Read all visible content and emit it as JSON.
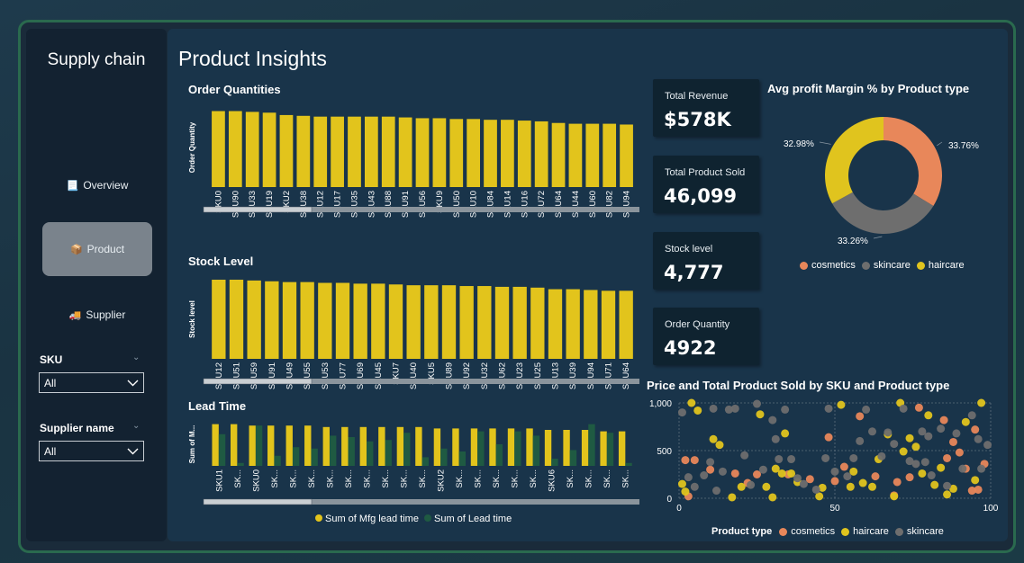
{
  "app": {
    "title": "Supply chain"
  },
  "nav": [
    {
      "label": "Overview",
      "icon": "document-icon"
    },
    {
      "label": "Product",
      "icon": "box-icon"
    },
    {
      "label": "Supplier",
      "icon": "truck-icon"
    }
  ],
  "filters": {
    "sku": {
      "label": "SKU",
      "value": "All"
    },
    "supplier": {
      "label": "Supplier name",
      "value": "All"
    }
  },
  "page": {
    "title": "Product Insights"
  },
  "colors": {
    "yellow": "#e2c41c",
    "green": "#1f5a42",
    "cosmetics": "#e8875a",
    "skincare": "#6e6e6e",
    "haircare": "#e0c41e"
  },
  "kpis": [
    {
      "label": "Total Revenue",
      "value": "$578K"
    },
    {
      "label": "Total Product Sold",
      "value": "46,099"
    },
    {
      "label": "Stock level",
      "value": "4,777"
    },
    {
      "label": "Order Quantity",
      "value": "4922"
    }
  ],
  "order_quantities": {
    "title": "Order Quantities",
    "ylabel": "Order Quantity"
  },
  "stock_level": {
    "title": "Stock Level",
    "ylabel": "Stock level"
  },
  "lead_time": {
    "title": "Lead Time",
    "ylabel": "Sum of M...",
    "legend": [
      "Sum of Mfg lead time",
      "Sum of Lead time"
    ]
  },
  "donut": {
    "title": "Avg profit Margin % by Product type",
    "labels": [
      "33.76%",
      "33.26%",
      "32.98%"
    ],
    "legend": [
      "cosmetics",
      "skincare",
      "haircare"
    ]
  },
  "scatter": {
    "title": "Price and Total Product Sold by SKU and Product type",
    "legend_title": "Product type",
    "legend": [
      "cosmetics",
      "haircare",
      "skincare"
    ],
    "y_ticks": [
      "1,000",
      "500",
      "0"
    ],
    "x_ticks": [
      "0",
      "50",
      "100"
    ]
  },
  "chart_data": [
    {
      "type": "bar",
      "title": "Order Quantities",
      "xlabel": "",
      "ylabel": "Order Quantity",
      "categories": [
        "SKU0",
        "SKU90",
        "SKU33",
        "SKU19",
        "SKU2",
        "SKU38",
        "SKU12",
        "SKU17",
        "SKU35",
        "SKU43",
        "SKU88",
        "SKU91",
        "SKU56",
        "SKU9",
        "SKU50",
        "SKU10",
        "SKU84",
        "SKU14",
        "SKU16",
        "SKU72",
        "SKU64",
        "SKU44",
        "SKU60",
        "SKU82",
        "SKU94"
      ],
      "values": [
        96,
        96,
        95,
        94,
        91,
        90,
        89,
        89,
        89,
        89,
        89,
        88,
        87,
        87,
        86,
        86,
        85,
        85,
        84,
        83,
        81,
        80,
        80,
        80,
        79
      ],
      "ylim": [
        0,
        100
      ]
    },
    {
      "type": "bar",
      "title": "Stock Level",
      "xlabel": "",
      "ylabel": "Stock level",
      "categories": [
        "SKU12",
        "SKU51",
        "SKU59",
        "SKU91",
        "SKU49",
        "SKU55",
        "SKU53",
        "SKU77",
        "SKU69",
        "SKU45",
        "SKU7",
        "SKU40",
        "SKU5",
        "SKU89",
        "SKU92",
        "SKU32",
        "SKU62",
        "SKU23",
        "SKU25",
        "SKU13",
        "SKU39",
        "SKU94",
        "SKU71",
        "SKU64"
      ],
      "values": [
        100,
        100,
        99,
        98,
        97,
        97,
        96,
        96,
        95,
        95,
        94,
        93,
        93,
        93,
        92,
        92,
        91,
        91,
        90,
        88,
        88,
        87,
        86,
        86
      ],
      "ylim": [
        0,
        100
      ]
    },
    {
      "type": "bar",
      "title": "Lead Time",
      "xlabel": "",
      "ylabel": "Sum of M...",
      "categories": [
        "SKU1",
        "SK...",
        "SKU0",
        "SK...",
        "SK...",
        "SK...",
        "SK...",
        "SK...",
        "SK...",
        "SK...",
        "SK...",
        "SK...",
        "SKU2",
        "SK...",
        "SK...",
        "SK...",
        "SK...",
        "SK...",
        "SKU6",
        "SK...",
        "SK...",
        "SK...",
        "SK..."
      ],
      "series": [
        {
          "name": "Sum of Mfg lead time",
          "values": [
            29,
            29,
            28,
            28,
            28,
            28,
            27,
            27,
            27,
            27,
            27,
            27,
            26,
            26,
            26,
            26,
            26,
            26,
            25,
            25,
            25,
            24,
            24
          ]
        },
        {
          "name": "Sum of Lead time",
          "values": [
            22,
            2,
            28,
            7,
            13,
            12,
            21,
            20,
            17,
            18,
            23,
            6,
            12,
            10,
            24,
            15,
            24,
            21,
            5,
            11,
            29,
            23,
            2
          ]
        }
      ],
      "ylim": [
        0,
        30
      ]
    },
    {
      "type": "pie",
      "title": "Avg profit Margin % by Product type",
      "categories": [
        "cosmetics",
        "skincare",
        "haircare"
      ],
      "values": [
        33.76,
        33.26,
        32.98
      ]
    },
    {
      "type": "scatter",
      "title": "Price and Total Product Sold by SKU and Product type",
      "xlim": [
        0,
        100
      ],
      "ylim": [
        0,
        1000
      ],
      "series": [
        {
          "name": "cosmetics",
          "points": [
            [
              2,
              400
            ],
            [
              3,
              20
            ],
            [
              5,
              400
            ],
            [
              10,
              300
            ],
            [
              18,
              260
            ],
            [
              22,
              160
            ],
            [
              25,
              250
            ],
            [
              35,
              250
            ],
            [
              42,
              200
            ],
            [
              48,
              640
            ],
            [
              50,
              180
            ],
            [
              53,
              330
            ],
            [
              58,
              860
            ],
            [
              63,
              230
            ],
            [
              69,
              30
            ],
            [
              70,
              170
            ],
            [
              74,
              220
            ],
            [
              77,
              950
            ],
            [
              85,
              820
            ],
            [
              86,
              420
            ],
            [
              88,
              590
            ],
            [
              90,
              480
            ],
            [
              92,
              310
            ],
            [
              94,
              80
            ],
            [
              95,
              720
            ],
            [
              96,
              90
            ],
            [
              98,
              360
            ]
          ]
        },
        {
          "name": "haircare",
          "points": [
            [
              1,
              150
            ],
            [
              2,
              70
            ],
            [
              4,
              1000
            ],
            [
              6,
              920
            ],
            [
              11,
              620
            ],
            [
              13,
              560
            ],
            [
              17,
              10
            ],
            [
              20,
              120
            ],
            [
              26,
              880
            ],
            [
              28,
              120
            ],
            [
              30,
              10
            ],
            [
              31,
              310
            ],
            [
              33,
              260
            ],
            [
              34,
              680
            ],
            [
              36,
              260
            ],
            [
              38,
              170
            ],
            [
              45,
              20
            ],
            [
              46,
              110
            ],
            [
              52,
              980
            ],
            [
              55,
              120
            ],
            [
              56,
              280
            ],
            [
              59,
              160
            ],
            [
              62,
              120
            ],
            [
              64,
              410
            ],
            [
              67,
              670
            ],
            [
              69,
              20
            ],
            [
              71,
              1000
            ],
            [
              72,
              490
            ],
            [
              74,
              630
            ],
            [
              76,
              540
            ],
            [
              78,
              260
            ],
            [
              80,
              870
            ],
            [
              82,
              140
            ],
            [
              84,
              320
            ],
            [
              86,
              40
            ],
            [
              88,
              100
            ],
            [
              92,
              800
            ],
            [
              95,
              190
            ],
            [
              97,
              1000
            ]
          ]
        },
        {
          "name": "skincare",
          "points": [
            [
              1,
              900
            ],
            [
              3,
              220
            ],
            [
              5,
              120
            ],
            [
              8,
              240
            ],
            [
              10,
              380
            ],
            [
              11,
              940
            ],
            [
              12,
              80
            ],
            [
              14,
              280
            ],
            [
              16,
              930
            ],
            [
              18,
              940
            ],
            [
              21,
              450
            ],
            [
              23,
              140
            ],
            [
              25,
              990
            ],
            [
              27,
              300
            ],
            [
              30,
              820
            ],
            [
              31,
              620
            ],
            [
              32,
              410
            ],
            [
              34,
              930
            ],
            [
              36,
              410
            ],
            [
              38,
              210
            ],
            [
              40,
              150
            ],
            [
              44,
              90
            ],
            [
              47,
              420
            ],
            [
              48,
              940
            ],
            [
              50,
              280
            ],
            [
              54,
              230
            ],
            [
              56,
              420
            ],
            [
              58,
              600
            ],
            [
              60,
              930
            ],
            [
              62,
              700
            ],
            [
              65,
              440
            ],
            [
              67,
              690
            ],
            [
              69,
              570
            ],
            [
              72,
              940
            ],
            [
              74,
              390
            ],
            [
              76,
              360
            ],
            [
              78,
              700
            ],
            [
              79,
              380
            ],
            [
              80,
              650
            ],
            [
              81,
              240
            ],
            [
              84,
              730
            ],
            [
              86,
              130
            ],
            [
              89,
              680
            ],
            [
              91,
              310
            ],
            [
              94,
              870
            ],
            [
              96,
              620
            ],
            [
              97,
              310
            ],
            [
              99,
              560
            ]
          ]
        }
      ]
    }
  ]
}
